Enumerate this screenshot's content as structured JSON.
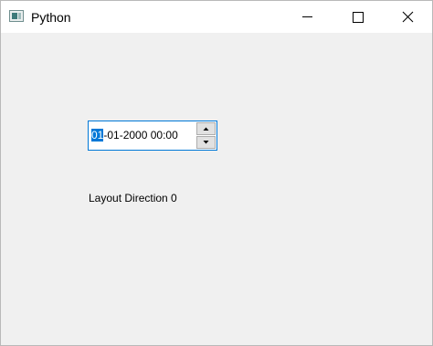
{
  "window": {
    "title": "Python",
    "icons": {
      "app": "python-app-icon",
      "minimize": "minimize-icon",
      "maximize": "maximize-icon",
      "close": "close-icon"
    }
  },
  "datetime_edit": {
    "selected_section": "01",
    "rest_text": "-01-2000 00:00",
    "up_icon": "spin-up-arrow-icon",
    "down_icon": "spin-down-arrow-icon"
  },
  "label": {
    "text": "Layout Direction 0"
  },
  "colors": {
    "accent": "#0078d7",
    "window_bg": "#f0f0f0",
    "titlebar_bg": "#ffffff"
  }
}
